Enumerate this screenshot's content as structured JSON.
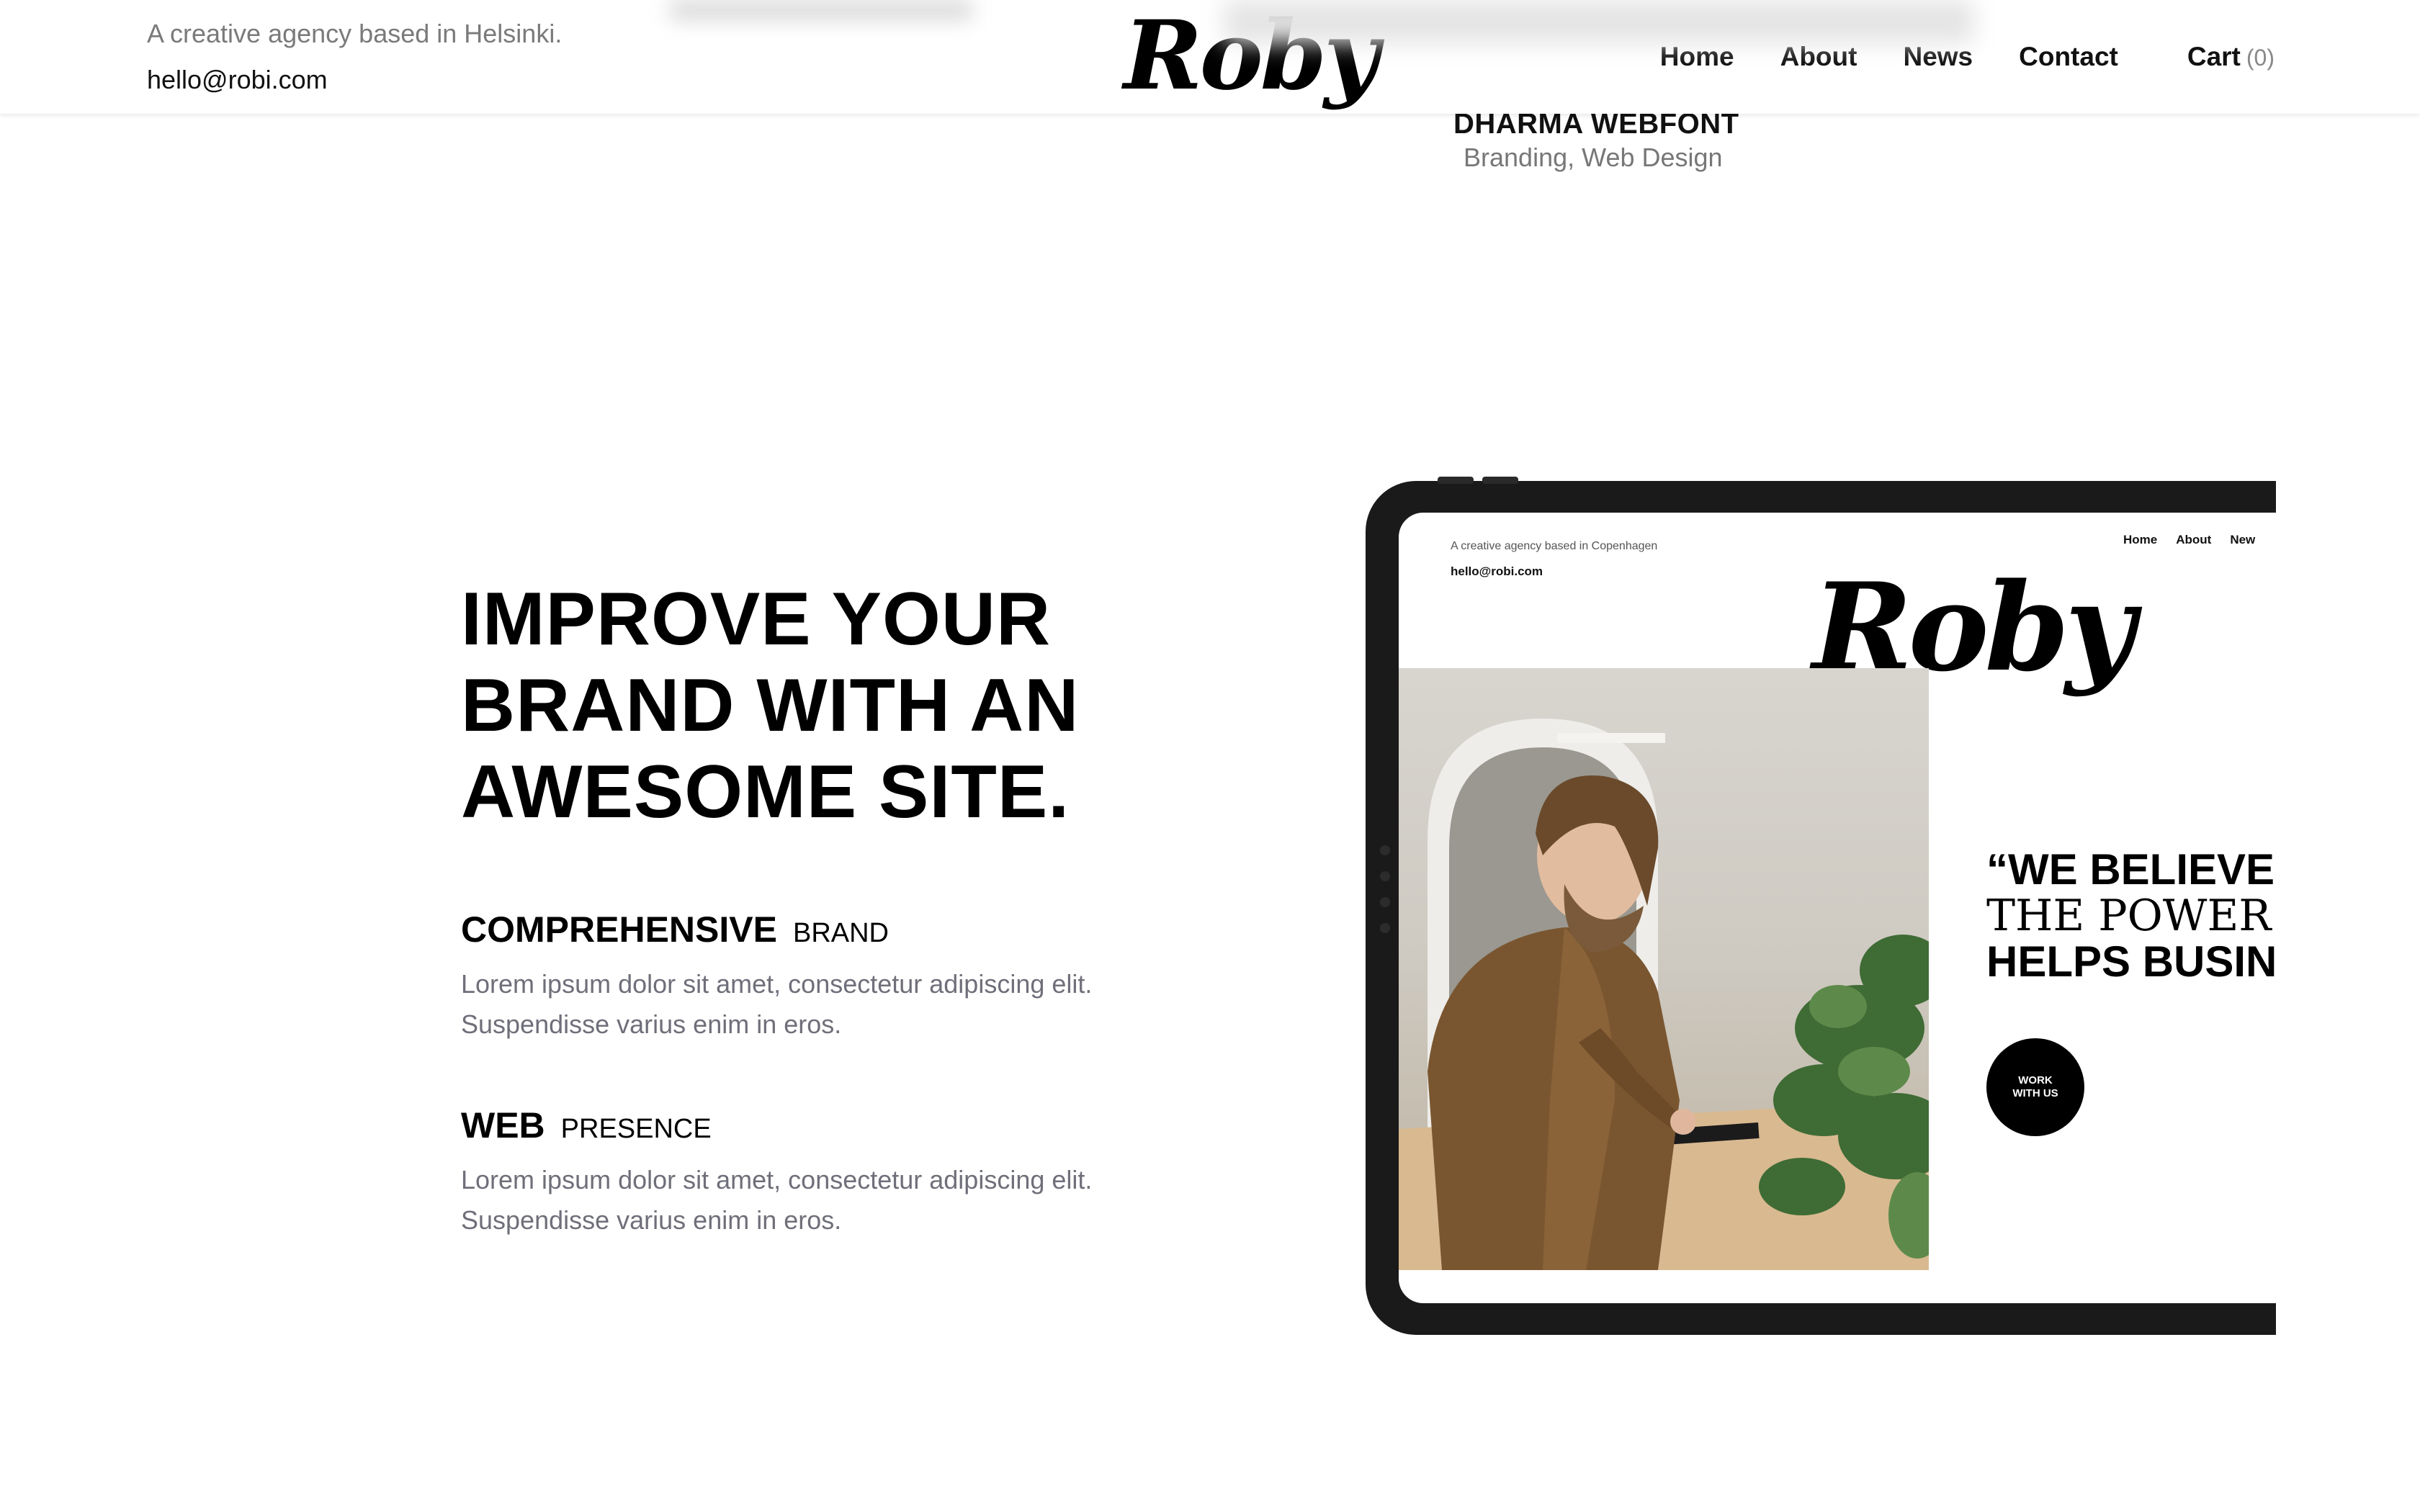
{
  "header": {
    "tagline": "A creative agency based in Helsinki.",
    "email": "hello@robi.com",
    "logo_text": "Roby",
    "nav": [
      "Home",
      "About",
      "News",
      "Contact"
    ],
    "cart_label": "Cart",
    "cart_count": "(0)"
  },
  "project": {
    "title": "DHARMA WEBFONT",
    "categories": "Branding, Web Design"
  },
  "hero": {
    "line1_bold": "IMPROVE",
    "line1_rest": " YOUR",
    "line2_light": "BRAND ",
    "line2_bold": "WITH AN",
    "line3_bold": "AWESOME SITE."
  },
  "features": [
    {
      "title": "COMPREHENSIVE",
      "subtitle": "BRAND",
      "text_line1": "Lorem ipsum dolor sit amet, consectetur adipiscing elit.",
      "text_line2": "Suspendisse varius enim in eros."
    },
    {
      "title": "WEB",
      "subtitle": "PRESENCE",
      "text_line1": "Lorem ipsum dolor sit amet, consectetur adipiscing elit.",
      "text_line2": "Suspendisse varius enim in eros."
    }
  ],
  "mockup": {
    "tagline": "A creative agency based in Copenhagen",
    "email": "hello@robi.com",
    "nav": [
      "Home",
      "About",
      "New"
    ],
    "logo_text": "Roby",
    "quote_line1": "“WE BELIEVE T",
    "quote_line2": "THE POWER OF D",
    "quote_line3": "HELPS BUSINE",
    "button_line1": "WORK",
    "button_line2": "WITH US"
  }
}
